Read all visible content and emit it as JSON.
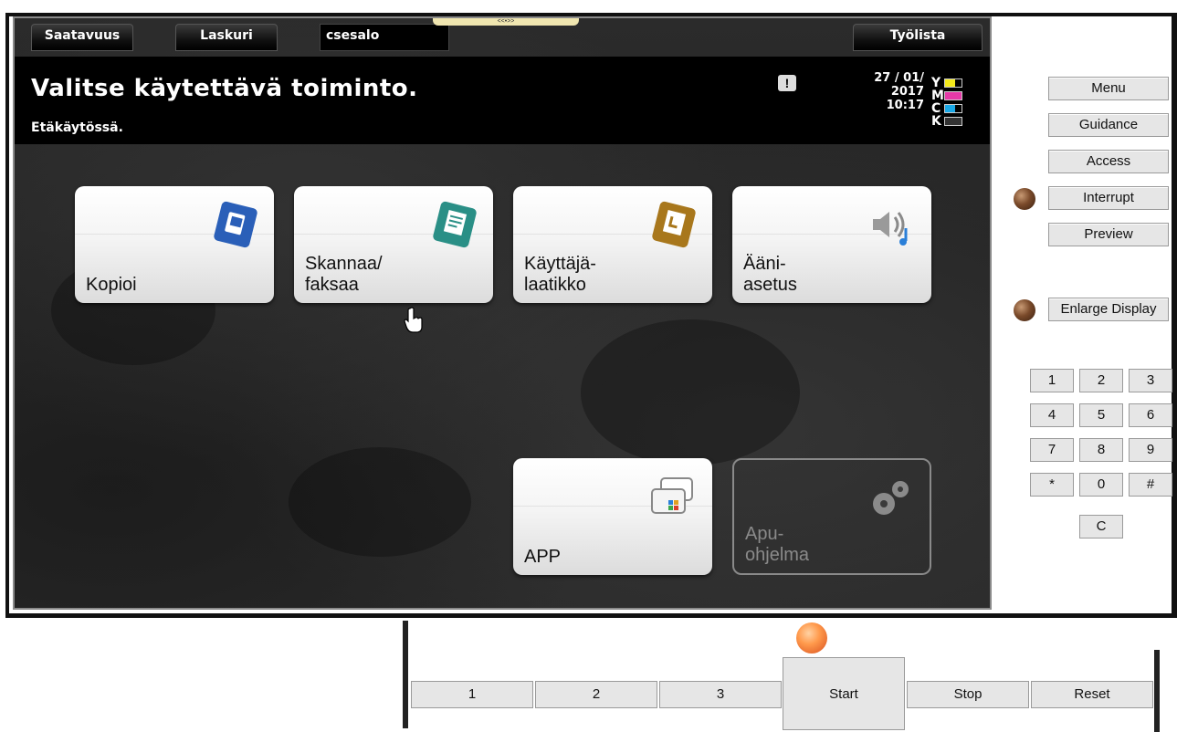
{
  "tabs": {
    "availability": "Saatavuus",
    "counter": "Laskuri",
    "user": "csesalo",
    "job_list": "Työlista",
    "handle": "<<•>>"
  },
  "header": {
    "title": "Valitse käytettävä toiminto.",
    "subtitle": "Etäkäytössä.",
    "warning_glyph": "!",
    "date": "27 / 01/ 2017",
    "time": "10:17",
    "toner": [
      {
        "letter": "Y",
        "color": "#f2e81a"
      },
      {
        "letter": "M",
        "color": "#e63aa8"
      },
      {
        "letter": "C",
        "color": "#1aa8e6"
      },
      {
        "letter": "K",
        "color": "#333333"
      }
    ]
  },
  "tiles": {
    "copy": "Kopioi",
    "scan_fax": "Skannaa/\nfaksaa",
    "user_box": "Käyttäjä-\nlaatikko",
    "sound": "Ääni-\nasetus",
    "app": "APP",
    "utility": "Apu-\nohjelma"
  },
  "panel": {
    "menu": "Menu",
    "guidance": "Guidance",
    "access": "Access",
    "interrupt": "Interrupt",
    "preview": "Preview",
    "enlarge_display": "Enlarge Display",
    "keypad": [
      "1",
      "2",
      "3",
      "4",
      "5",
      "6",
      "7",
      "8",
      "9",
      "*",
      "0",
      "#"
    ],
    "clear": "C"
  },
  "bottom": {
    "mem1": "1",
    "mem2": "2",
    "mem3": "3",
    "start": "Start",
    "stop": "Stop",
    "reset": "Reset"
  },
  "colors": {
    "screen_bg": "#262626",
    "header_bg": "#000000",
    "button_bg": "#e6e6e6",
    "start_led": "#ff9a4c"
  }
}
